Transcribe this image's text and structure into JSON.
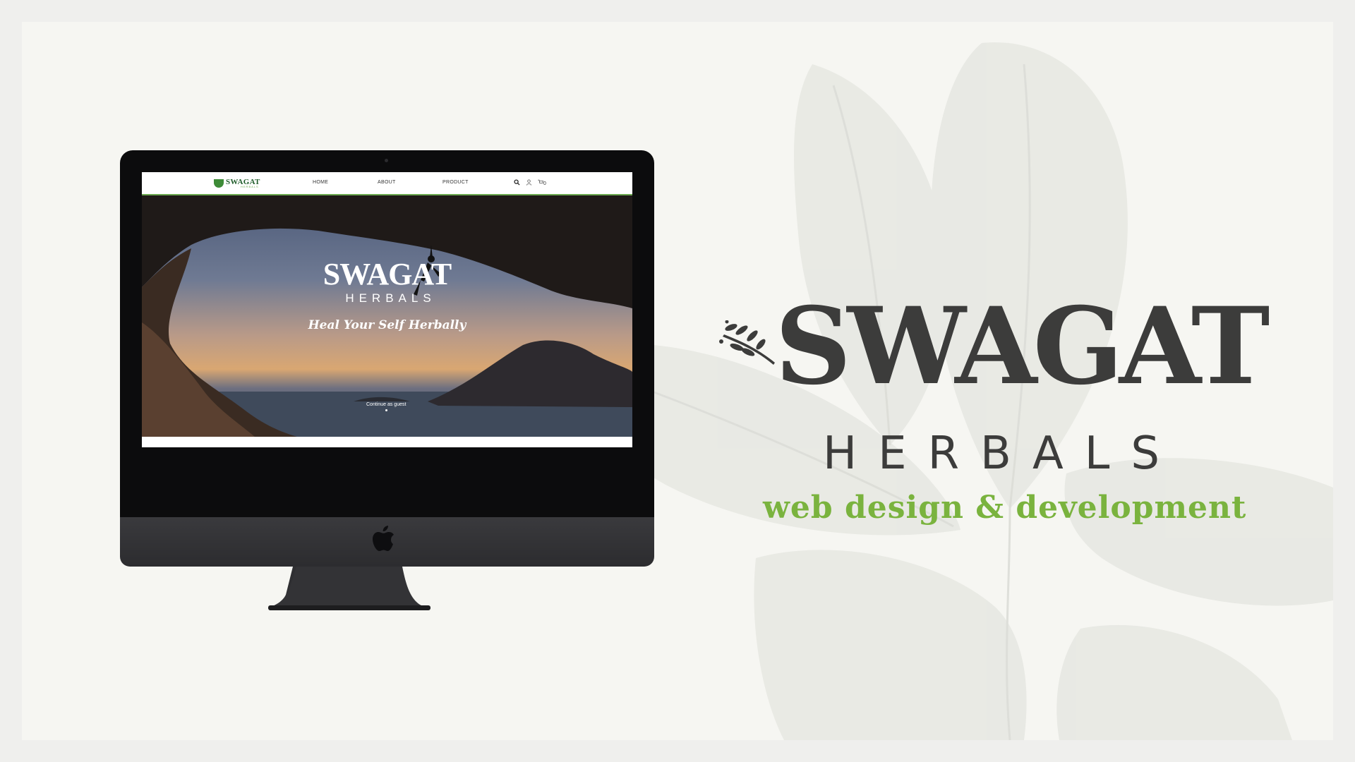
{
  "colors": {
    "brand_dark": "#3c3c3b",
    "brand_green": "#7ab33e",
    "site_green": "#6aa84f",
    "background": "#f6f6f2"
  },
  "site": {
    "logo_text": "SWAGAT",
    "logo_sub": "HERBALS",
    "nav": {
      "home": "HOME",
      "about": "ABOUT",
      "product": "PRODUCT",
      "cart_count": "0",
      "search_icon": "search-icon",
      "user_icon": "user-icon",
      "cart_icon": "cart-icon"
    },
    "hero": {
      "title": "SWAGAT",
      "subtitle": "HERBALS",
      "tagline": "Heal Your Self Herbally",
      "guest_link": "Continue as guest"
    }
  },
  "brand": {
    "title": "SWAGAT",
    "subtitle": "HERBALS",
    "tagline": "web design & development"
  }
}
